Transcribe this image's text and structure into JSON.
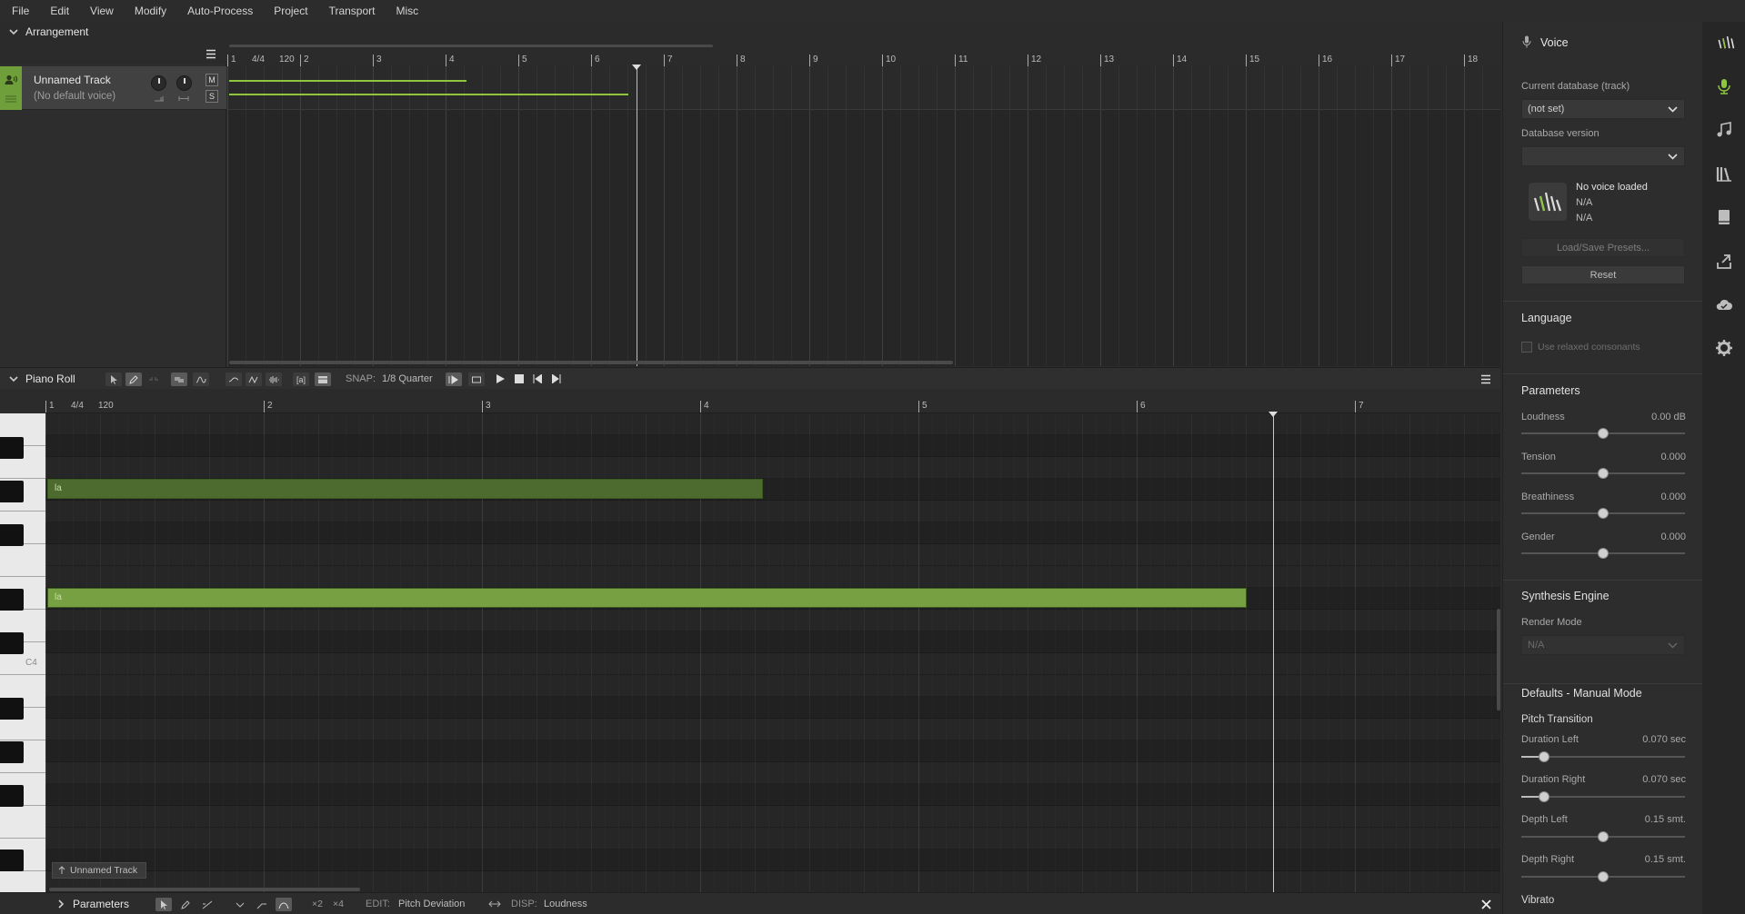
{
  "menu": [
    "File",
    "Edit",
    "View",
    "Modify",
    "Auto-Process",
    "Project",
    "Transport",
    "Misc"
  ],
  "arrangement": {
    "title": "Arrangement",
    "ruler": {
      "ts": "4/4",
      "tempo": "120",
      "bars": [
        "1",
        "2",
        "3",
        "4",
        "5",
        "6",
        "7",
        "8",
        "9",
        "10",
        "11",
        "12",
        "13",
        "14",
        "15",
        "16",
        "17",
        "18"
      ]
    },
    "track": {
      "name": "Unnamed Track",
      "voice": "(No default voice)",
      "mute": "M",
      "solo": "S"
    }
  },
  "pianoroll": {
    "title": "Piano Roll",
    "snap_label": "SNAP:",
    "snap_value": "1/8 Quarter",
    "ruler": {
      "ts": "4/4",
      "tempo": "120",
      "bars": [
        "1",
        "2",
        "3",
        "4",
        "5",
        "6",
        "7"
      ]
    },
    "notes": [
      {
        "lyric": "la"
      },
      {
        "lyric": "la"
      }
    ],
    "c4_label": "C4",
    "track_chip": "Unnamed Track"
  },
  "params_bar": {
    "title": "Parameters",
    "x2": "×2",
    "x4": "×4",
    "edit_label": "EDIT:",
    "edit_value": "Pitch Deviation",
    "disp_label": "DISP:",
    "disp_value": "Loudness"
  },
  "voice_panel": {
    "title": "Voice",
    "db_label": "Current database (track)",
    "db_value": "(not set)",
    "ver_label": "Database version",
    "ver_value": "",
    "voice_status": "No voice loaded",
    "na1": "N/A",
    "na2": "N/A",
    "presets_btn": "Load/Save Presets...",
    "reset_btn": "Reset",
    "language_title": "Language",
    "relaxed": "Use relaxed consonants",
    "parameters_title": "Parameters",
    "params": [
      {
        "label": "Loudness",
        "value": "0.00 dB",
        "level": 0.5
      },
      {
        "label": "Tension",
        "value": "0.000",
        "level": 0.5
      },
      {
        "label": "Breathiness",
        "value": "0.000",
        "level": 0.5
      },
      {
        "label": "Gender",
        "value": "0.000",
        "level": 0.5
      }
    ],
    "synth_title": "Synthesis Engine",
    "render_label": "Render Mode",
    "render_value": "N/A",
    "defaults_title": "Defaults - Manual Mode",
    "pitch_trans": "Pitch Transition",
    "pt_params": [
      {
        "label": "Duration Left",
        "value": "0.070 sec",
        "level": 0.14
      },
      {
        "label": "Duration Right",
        "value": "0.070 sec",
        "level": 0.14
      },
      {
        "label": "Depth Left",
        "value": "0.15 smt.",
        "level": 0.5
      },
      {
        "label": "Depth Right",
        "value": "0.15 smt.",
        "level": 0.5
      }
    ],
    "vibrato": "Vibrato"
  },
  "colors": {
    "accent": "#8ec63f",
    "note": "#76a041",
    "note_dim": "#4d6b2e",
    "track": "#6f9f3a"
  },
  "side_icons": [
    "logo-icon",
    "microphone-icon",
    "music-note-icon",
    "library-icon",
    "book-icon",
    "export-icon",
    "cloud-icon",
    "gear-icon"
  ]
}
